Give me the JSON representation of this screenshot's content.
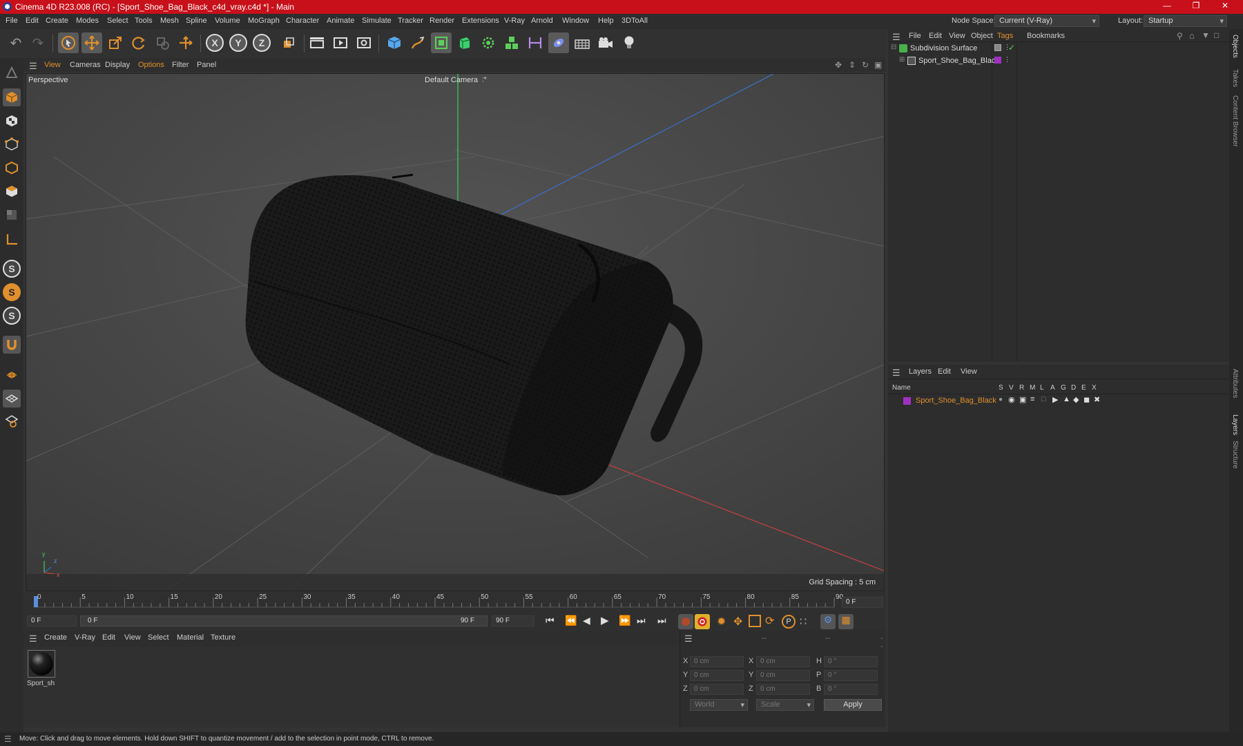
{
  "app": {
    "title": "Cinema 4D R23.008 (RC) - [Sport_Shoe_Bag_Black_c4d_vray.c4d *] - Main",
    "window_controls": {
      "minimize": "—",
      "restore": "❐",
      "close": "✕"
    }
  },
  "menubar": {
    "items": [
      "File",
      "Edit",
      "Create",
      "Modes",
      "Select",
      "Tools",
      "Mesh",
      "Spline",
      "Volume",
      "MoGraph",
      "Character",
      "Animate",
      "Simulate",
      "Tracker",
      "Render",
      "Extensions",
      "V-Ray",
      "Arnold",
      "Window",
      "Help",
      "3DToAll"
    ],
    "node_space_label": "Node Space:",
    "node_space_value": "Current (V-Ray)",
    "layout_label": "Layout:",
    "layout_value": "Startup"
  },
  "toolbar": {
    "undo": "↶",
    "redo": "↷",
    "axis_x": "X",
    "axis_y": "Y",
    "axis_z": "Z"
  },
  "left_tools": {
    "s1": "S",
    "s2": "S",
    "s3": "S"
  },
  "viewport": {
    "menu": [
      "View",
      "Cameras",
      "Display",
      "Options",
      "Filter",
      "Panel"
    ],
    "label": "Perspective",
    "camera": "Default Camera",
    "camera_suffix": ":*",
    "grid_spacing": "Grid Spacing : 5 cm",
    "axis_y": "y",
    "axis_z": "z",
    "axis_x": "x"
  },
  "timeline": {
    "ticks": [
      "0",
      "5",
      "10",
      "15",
      "20",
      "25",
      "30",
      "35",
      "40",
      "45",
      "50",
      "55",
      "60",
      "65",
      "70",
      "75",
      "80",
      "85",
      "90"
    ],
    "current_frame": "0 F"
  },
  "transport": {
    "start_field": "0 F",
    "range_start": "0 F",
    "range_end": "90 F",
    "end_field": "90 F"
  },
  "material_panel": {
    "menu": [
      "Create",
      "V-Ray",
      "Edit",
      "View",
      "Select",
      "Material",
      "Texture"
    ],
    "material_name": "Sport_sh"
  },
  "coords": {
    "headers": [
      "--",
      "--",
      "--"
    ],
    "rows": [
      {
        "a": "X",
        "av": "0 cm",
        "b": "X",
        "bv": "0 cm",
        "c": "H",
        "cv": "0 °"
      },
      {
        "a": "Y",
        "av": "0 cm",
        "b": "Y",
        "bv": "0 cm",
        "c": "P",
        "cv": "0 °"
      },
      {
        "a": "Z",
        "av": "0 cm",
        "b": "Z",
        "bv": "0 cm",
        "c": "B",
        "cv": "0 °"
      }
    ],
    "space": "World",
    "mode": "Scale",
    "apply": "Apply"
  },
  "object_panel": {
    "menu": [
      "File",
      "Edit",
      "View",
      "Object",
      "Tags",
      "Bookmarks"
    ],
    "objects": [
      "Subdivision Surface",
      "Sport_Shoe_Bag_Black"
    ]
  },
  "layer_panel": {
    "menu": [
      "Layers",
      "Edit",
      "View"
    ],
    "columns_name": "Name",
    "columns": [
      "S",
      "V",
      "R",
      "M",
      "L",
      "A",
      "G",
      "D",
      "E",
      "X"
    ],
    "layer_name": "Sport_Shoe_Bag_Black"
  },
  "side_tabs": [
    "Objects",
    "Takes",
    "Content Browser",
    "Attributes",
    "Layers",
    "Structure"
  ],
  "status": "Move: Click and drag to move elements. Hold down SHIFT to quantize movement / add to the selection in point mode, CTRL to remove.",
  "colors": {
    "titlebar": "#c8101a",
    "accent": "#e0902c",
    "layer": "#a030c0"
  }
}
